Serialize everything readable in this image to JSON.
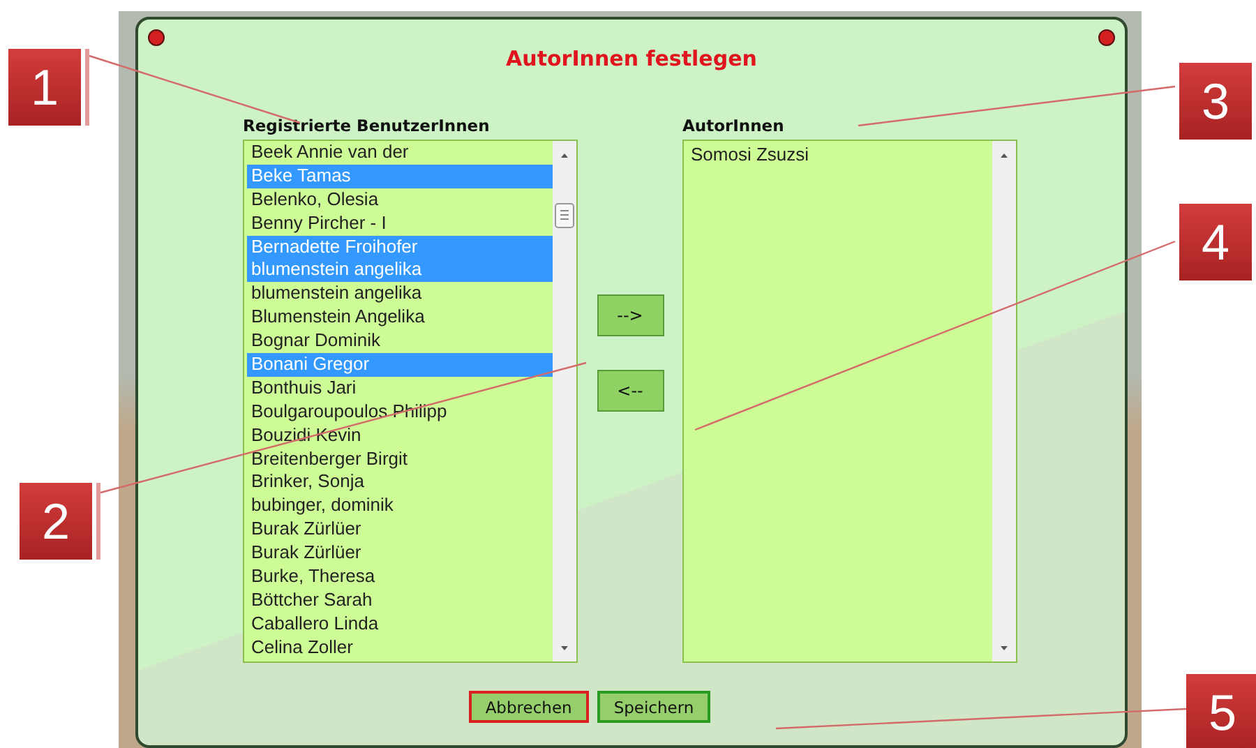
{
  "dialog": {
    "title": "AutorInnen festlegen"
  },
  "registered_users": {
    "heading": "Registrierte BenutzerInnen",
    "items": [
      {
        "label": "Beek Annie van der",
        "selected": false
      },
      {
        "label": "Beke Tamas",
        "selected": true
      },
      {
        "label": "Belenko, Olesia",
        "selected": false
      },
      {
        "label": "Benny Pircher - I",
        "selected": false
      },
      {
        "label": "Bernadette Froihofer",
        "selected": true
      },
      {
        "label": "blumenstein angelika",
        "selected": true
      },
      {
        "label": "blumenstein angelika",
        "selected": false
      },
      {
        "label": "Blumenstein Angelika",
        "selected": false
      },
      {
        "label": "Bognar Dominik",
        "selected": false
      },
      {
        "label": "Bonani Gregor",
        "selected": true
      },
      {
        "label": "Bonthuis Jari",
        "selected": false
      },
      {
        "label": "Boulgaroupoulos Philipp",
        "selected": false
      },
      {
        "label": "Bouzidi Kevin",
        "selected": false
      },
      {
        "label": "Breitenberger Birgit",
        "selected": false
      },
      {
        "label": "Brinker, Sonja",
        "selected": false
      },
      {
        "label": "bubinger, dominik",
        "selected": false
      },
      {
        "label": "Burak Zürlüer",
        "selected": false
      },
      {
        "label": "Burak Zürlüer",
        "selected": false
      },
      {
        "label": "Burke, Theresa",
        "selected": false
      },
      {
        "label": "Böttcher Sarah",
        "selected": false
      },
      {
        "label": "Caballero Linda",
        "selected": false
      },
      {
        "label": "Celina Zoller",
        "selected": false
      }
    ]
  },
  "move_buttons": [
    {
      "label": "-->"
    },
    {
      "label": "<--"
    }
  ],
  "authors": {
    "heading": "AutorInnen",
    "items": [
      {
        "label": "Somosi Zsuzsi",
        "selected": false
      }
    ]
  },
  "footer_buttons": [
    {
      "label": "Abbrechen",
      "kind": "cancel"
    },
    {
      "label": "Speichern",
      "kind": "save"
    }
  ],
  "callouts": [
    {
      "number": "1"
    },
    {
      "number": "2"
    },
    {
      "number": "3"
    },
    {
      "number": "4"
    },
    {
      "number": "5"
    }
  ]
}
